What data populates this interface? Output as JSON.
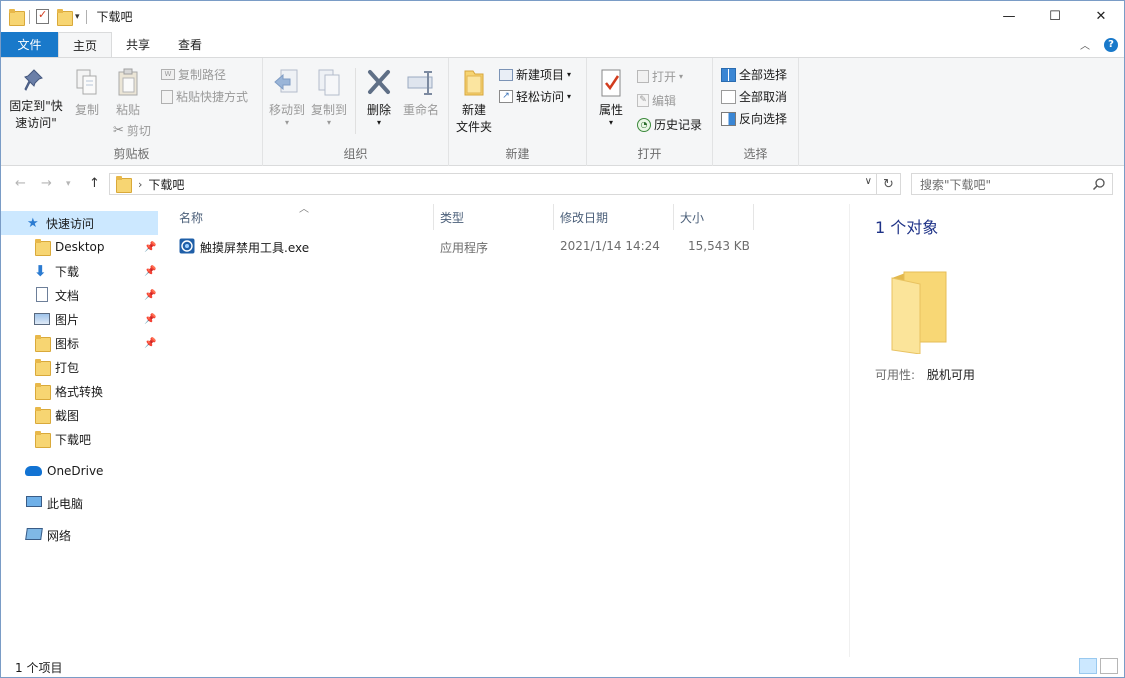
{
  "window": {
    "title": "下载吧"
  },
  "window_buttons": {
    "minimize": "—",
    "maximize": "☐",
    "close": "✕"
  },
  "tabs": {
    "file": "文件",
    "home": "主页",
    "share": "共享",
    "view": "查看"
  },
  "ribbon": {
    "clipboard": {
      "label": "剪贴板",
      "pin_line1": "固定到\"快",
      "pin_line2": "速访问\"",
      "copy": "复制",
      "paste": "粘贴",
      "copy_path": "复制路径",
      "paste_shortcut": "粘贴快捷方式",
      "cut": "剪切"
    },
    "organize": {
      "label": "组织",
      "move_to": "移动到",
      "copy_to": "复制到",
      "delete": "删除",
      "rename": "重命名"
    },
    "new": {
      "label": "新建",
      "new_folder_line1": "新建",
      "new_folder_line2": "文件夹",
      "new_item": "新建项目",
      "easy_access": "轻松访问"
    },
    "open": {
      "label": "打开",
      "properties": "属性",
      "open": "打开",
      "edit": "编辑",
      "history": "历史记录"
    },
    "select": {
      "label": "选择",
      "select_all": "全部选择",
      "select_none": "全部取消",
      "invert": "反向选择"
    }
  },
  "address": {
    "path": "下载吧",
    "search_placeholder": "搜索\"下载吧\""
  },
  "nav": {
    "quick_access": "快速访问",
    "items": [
      "Desktop",
      "下载",
      "文档",
      "图片",
      "图标",
      "打包",
      "格式转换",
      "截图",
      "下载吧"
    ],
    "onedrive": "OneDrive",
    "this_pc": "此电脑",
    "network": "网络"
  },
  "columns": {
    "name": "名称",
    "type": "类型",
    "modified": "修改日期",
    "size": "大小"
  },
  "files": [
    {
      "name": "触摸屏禁用工具.exe",
      "type": "应用程序",
      "modified": "2021/1/14 14:24",
      "size": "15,543 KB"
    }
  ],
  "details": {
    "count": "1 个对象",
    "availability_label": "可用性:",
    "availability_value": "脱机可用"
  },
  "status": {
    "items": "1 个项目"
  }
}
